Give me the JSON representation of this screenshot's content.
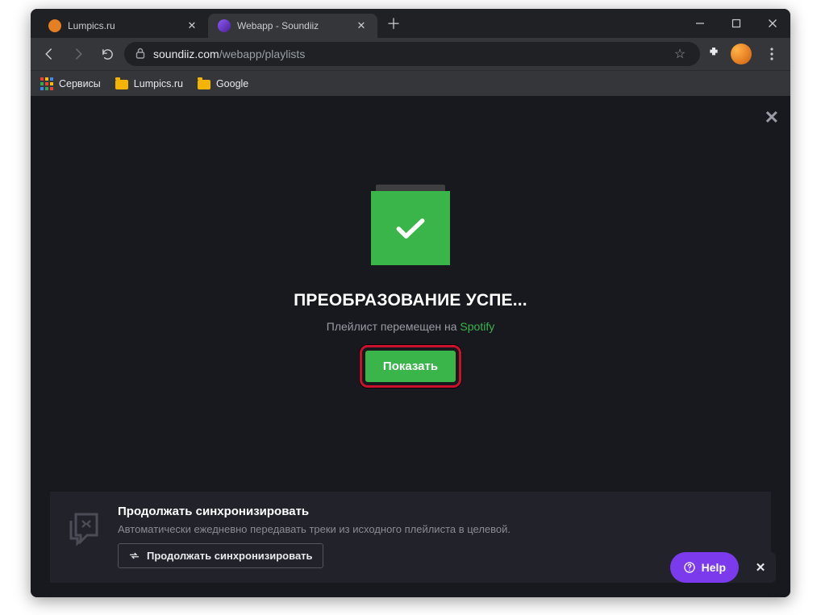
{
  "tabs": [
    {
      "title": "Lumpics.ru",
      "favicon_color": "#e67e22",
      "active": false
    },
    {
      "title": "Webapp - Soundiiz",
      "favicon_color": "#6b3fa0",
      "active": true
    }
  ],
  "address": {
    "domain": "soundiiz.com",
    "path": "/webapp/playlists"
  },
  "bookmarks": {
    "services": "Сервисы",
    "lumpics": "Lumpics.ru",
    "google": "Google"
  },
  "modal": {
    "title": "ПРЕОБРАЗОВАНИЕ УСПЕ...",
    "subtitle_prefix": "Плейлист перемещен на ",
    "subtitle_service": "Spotify",
    "show_button": "Показать"
  },
  "sync": {
    "title": "Продолжать синхронизировать",
    "desc": "Автоматически ежедневно передавать треки из исходного плейлиста в целевой.",
    "button": "Продолжать синхронизировать"
  },
  "help": {
    "label": "Help"
  },
  "colors": {
    "accent_green": "#39b54a",
    "ring_red": "#c9112b",
    "help_purple": "#7c3aed"
  }
}
